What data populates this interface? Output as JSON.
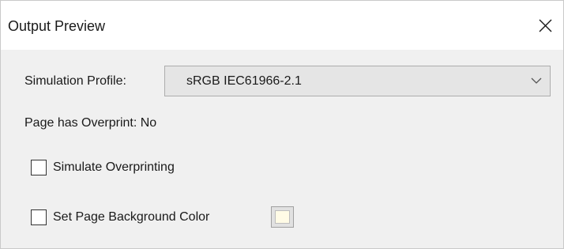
{
  "window": {
    "title": "Output Preview"
  },
  "simulation_profile": {
    "label": "Simulation Profile:",
    "selected": "sRGB IEC61966-2.1"
  },
  "overprint_status": {
    "text": "Page has Overprint: No"
  },
  "simulate_overprinting": {
    "label": "Simulate Overprinting",
    "checked": false
  },
  "page_background": {
    "label": "Set Page Background Color",
    "checked": false,
    "swatch_color": "#fffbe6"
  },
  "icons": {
    "close": "close-icon",
    "dropdown": "chevron-down-icon"
  }
}
